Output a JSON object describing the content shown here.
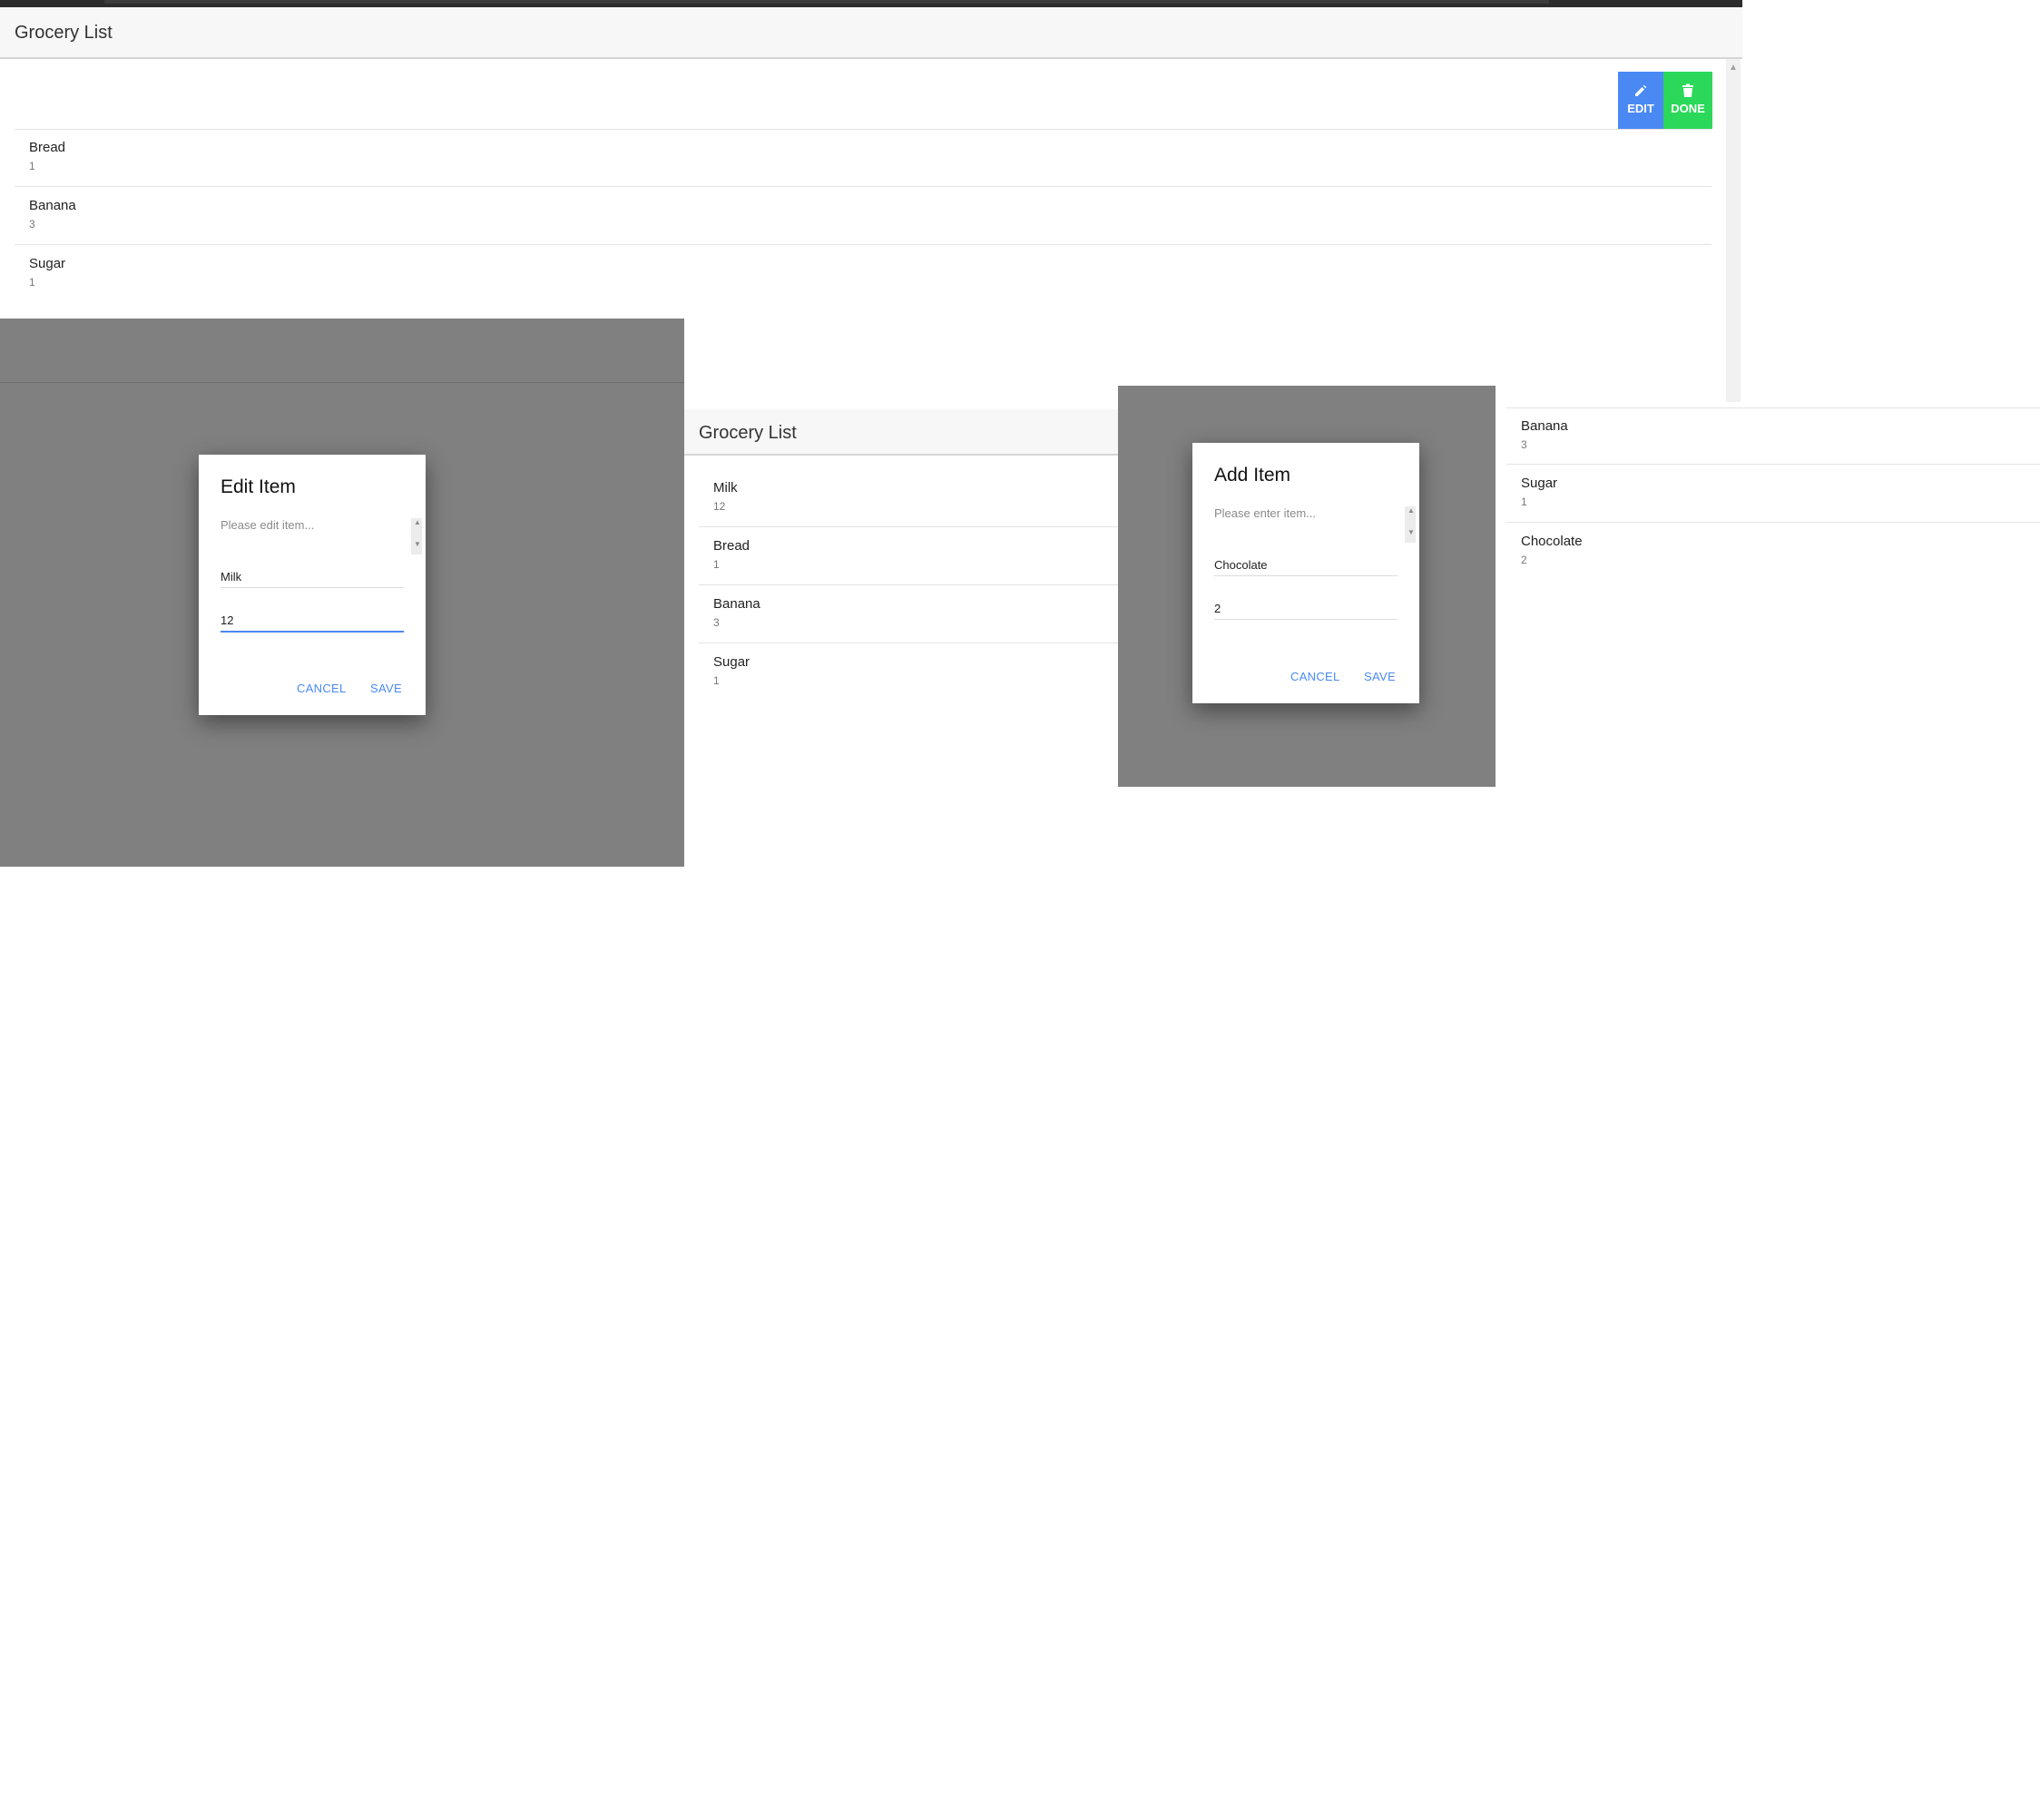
{
  "main_screen": {
    "title": "Grocery List",
    "swipe_actions": {
      "edit_label": "EDIT",
      "done_label": "DONE"
    },
    "items": [
      {
        "name": "Bread",
        "qty": "1"
      },
      {
        "name": "Banana",
        "qty": "3"
      },
      {
        "name": "Sugar",
        "qty": "1"
      }
    ]
  },
  "edit_dialog": {
    "title": "Edit Item",
    "message": "Please edit item...",
    "name_value": "Milk",
    "qty_value": "12",
    "cancel_label": "CANCEL",
    "save_label": "SAVE"
  },
  "list_after_edit": {
    "title": "Grocery List",
    "items": [
      {
        "name": "Milk",
        "qty": "12"
      },
      {
        "name": "Bread",
        "qty": "1"
      },
      {
        "name": "Banana",
        "qty": "3"
      },
      {
        "name": "Sugar",
        "qty": "1"
      }
    ]
  },
  "add_dialog": {
    "title": "Add Item",
    "message": "Please enter item...",
    "name_value": "Chocolate",
    "qty_value": "2",
    "cancel_label": "CANCEL",
    "save_label": "SAVE"
  },
  "list_after_add": {
    "items": [
      {
        "name": "Banana",
        "qty": "3"
      },
      {
        "name": "Sugar",
        "qty": "1"
      },
      {
        "name": "Chocolate",
        "qty": "2"
      }
    ]
  },
  "colors": {
    "accent": "#4a89f3",
    "done_green": "#2bd85a",
    "overlay": "#808080"
  }
}
